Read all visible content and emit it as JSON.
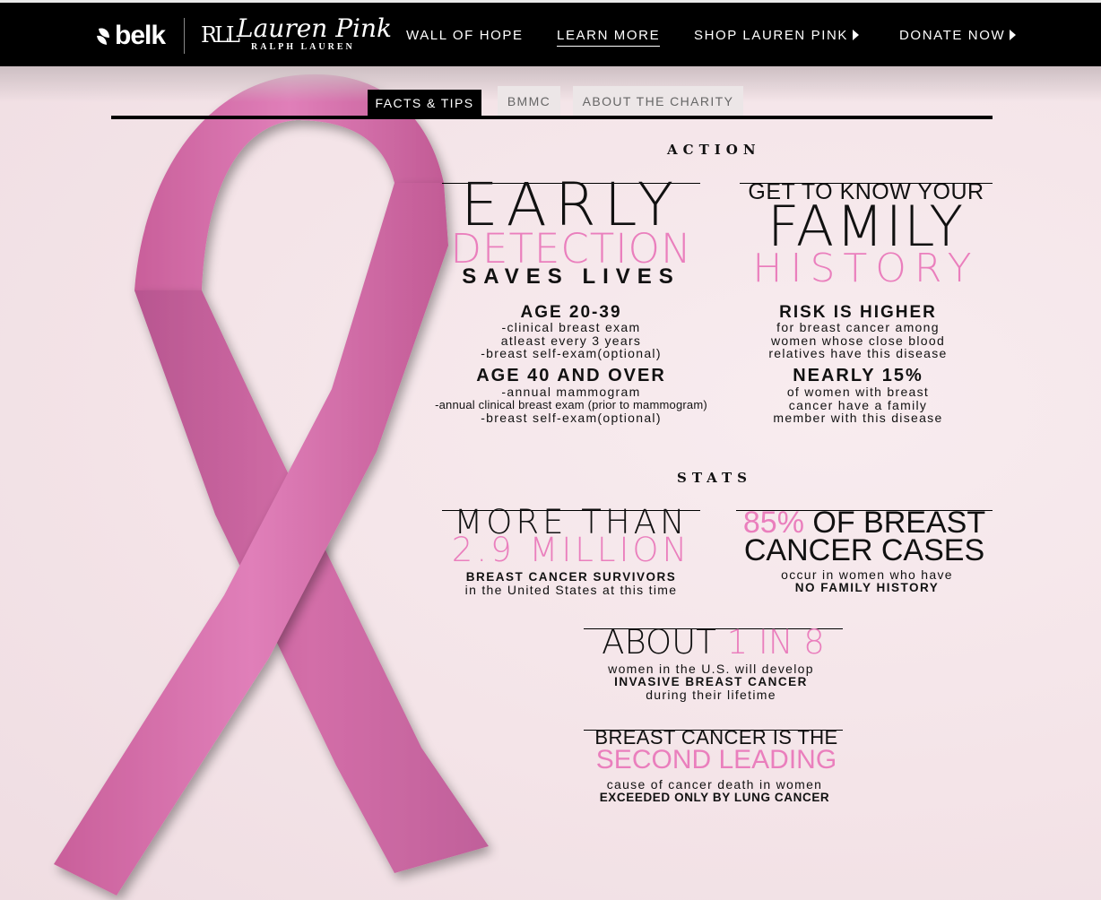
{
  "brand": {
    "store": "belk",
    "logo_mark": "RLL",
    "title": "Lauren Pink",
    "subtitle": "RALPH LAUREN"
  },
  "nav": {
    "items": [
      {
        "label": "WALL OF HOPE"
      },
      {
        "label": "LEARN MORE"
      },
      {
        "label": "SHOP LAUREN PINK"
      },
      {
        "label": "DONATE NOW"
      }
    ]
  },
  "tabs": [
    {
      "label": "FACTS & TIPS"
    },
    {
      "label": "BMMC"
    },
    {
      "label": "ABOUT THE CHARITY"
    }
  ],
  "action": {
    "label": "ACTION",
    "early": {
      "line1": "EARLY",
      "line2": "DETECTION",
      "line3": "SAVES LIVES",
      "age1": {
        "title": "AGE 20-39",
        "l1": "-clinical breast exam",
        "l2": "atleast every 3 years",
        "l3": "-breast self-exam(optional)"
      },
      "age2": {
        "title": "AGE 40 AND OVER",
        "l1": "-annual mammogram",
        "l2": "-annual clinical breast exam (prior to mammogram)",
        "l3": "-breast self-exam(optional)"
      }
    },
    "family": {
      "line1": "GET TO KNOW YOUR",
      "line2": "FAMILY",
      "line3": "HISTORY",
      "risk": {
        "title": "RISK IS HIGHER",
        "l1": "for breast cancer among",
        "l2": "women whose close blood",
        "l3": "relatives have this disease"
      },
      "nearly": {
        "title": "NEARLY 15%",
        "l1": "of women with breast",
        "l2": "cancer have a family",
        "l3": "member with this disease"
      }
    }
  },
  "stats": {
    "label": "STATS",
    "survivors": {
      "line1": "MORE THAN",
      "line2": "2.9 MILLION",
      "bold": "BREAST CANCER SURVIVORS",
      "text": "in the United States at this time"
    },
    "cases": {
      "pct": "85%",
      "line1_rest": " OF BREAST",
      "line2": "CANCER CASES",
      "text": "occur in women who have",
      "bold": "NO FAMILY HISTORY"
    },
    "about": {
      "word": "ABOUT ",
      "pink": "1 IN 8",
      "l1": "women in the U.S. will develop",
      "bold": "INVASIVE BREAST CANCER",
      "l2": "during their lifetime"
    },
    "second": {
      "line1": "BREAST CANCER IS THE",
      "line2": "SECOND LEADING",
      "l1": "cause of cancer death in women",
      "bold": "EXCEEDED ONLY BY LUNG CANCER"
    }
  },
  "colors": {
    "pink_accent": "#ea7fbd",
    "ribbon": "#d56fa9",
    "bar": "#000000"
  }
}
